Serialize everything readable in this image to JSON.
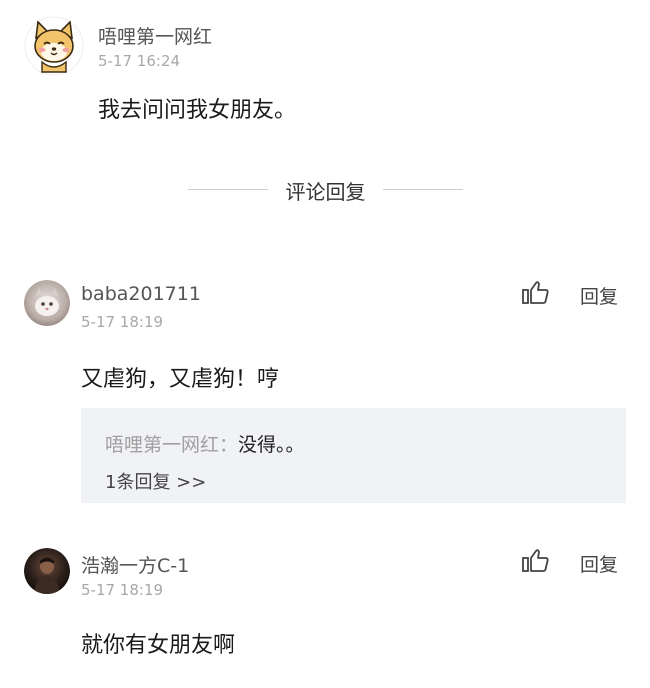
{
  "post": {
    "author": "唔哩第一网红",
    "time": "5-17 16:24",
    "text": "我去问问我女朋友。"
  },
  "divider": {
    "label": "评论回复"
  },
  "comments": [
    {
      "author": "baba201711",
      "time": "5-17 18:19",
      "text": "又虐狗，又虐狗！哼",
      "reply_label": "回复",
      "nested_reply": {
        "author": "唔哩第一网红：",
        "text": "没得。。",
        "more": "1条回复 >>"
      }
    },
    {
      "author": "浩瀚一方C-1",
      "time": "5-17 18:19",
      "text": "就你有女朋友啊",
      "reply_label": "回复"
    }
  ],
  "icons": {
    "post_avatar": "shiba-dog-avatar",
    "comment1_avatar": "cat-photo-avatar",
    "comment2_avatar": "person-photo-avatar",
    "like": "thumbs-up-icon"
  }
}
